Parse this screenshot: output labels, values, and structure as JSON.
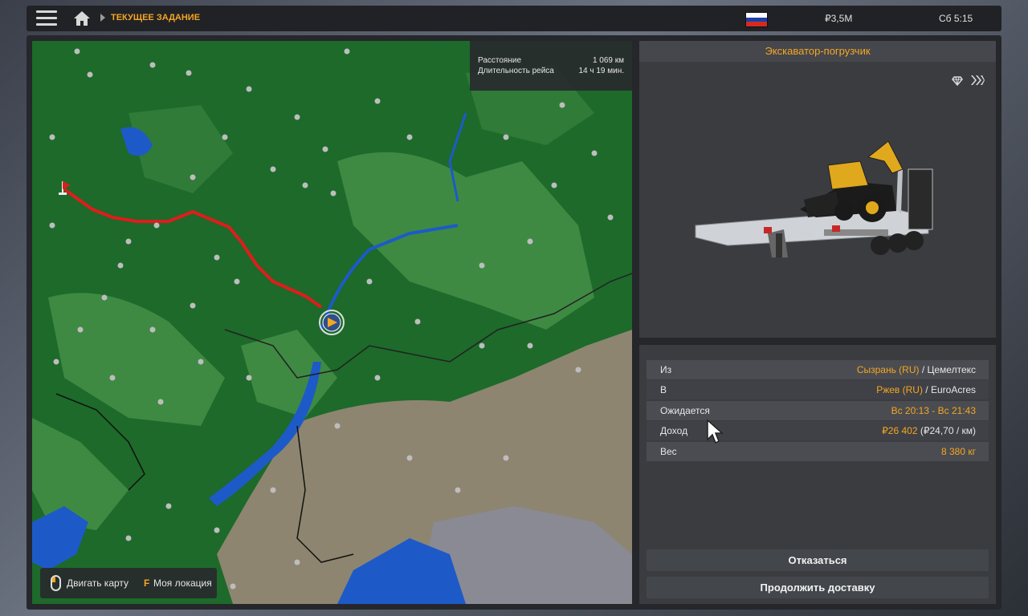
{
  "topbar": {
    "breadcrumb": "ТЕКУЩЕЕ ЗАДАНИЕ",
    "money": "₽3,5M",
    "time": "Сб 5:15",
    "flag_colors": [
      "#ffffff",
      "#1c3fa8",
      "#d52b1e"
    ]
  },
  "map": {
    "distance_label": "Расстояние",
    "distance_value": "1 069 км",
    "duration_label": "Длительность рейса",
    "duration_value": "14 ч 19 мин.",
    "move_map_label": "Двигать карту",
    "location_key": "F",
    "location_label": "Моя локация",
    "colors": {
      "forest": "#1d6a2a",
      "field": "#3e8a43",
      "steppe": "#8d8570",
      "water": "#1d5ac8",
      "route": "#e01c1c"
    }
  },
  "cargo": {
    "title": "Экскаватор-погрузчик",
    "icons": [
      "diamond-icon",
      "fast-forward-icon"
    ]
  },
  "details": {
    "rows": [
      {
        "label": "Из",
        "value_accent": "Сызрань (RU)",
        "value_rest": " / Цемелтекс"
      },
      {
        "label": "В",
        "value_accent": "Ржев (RU)",
        "value_rest": " / EuroAcres"
      },
      {
        "label": "Ожидается",
        "value_accent": "Вс 20:13 - Вс 21:43",
        "value_rest": ""
      },
      {
        "label": "Доход",
        "value_accent": "₽26 402",
        "value_rest": " (₽24,70 / км)"
      },
      {
        "label": "Вес",
        "value_accent": "8 380 кг",
        "value_rest": ""
      }
    ],
    "cancel_button": "Отказаться",
    "continue_button": "Продолжить доставку"
  },
  "accent_color": "#f5a623"
}
